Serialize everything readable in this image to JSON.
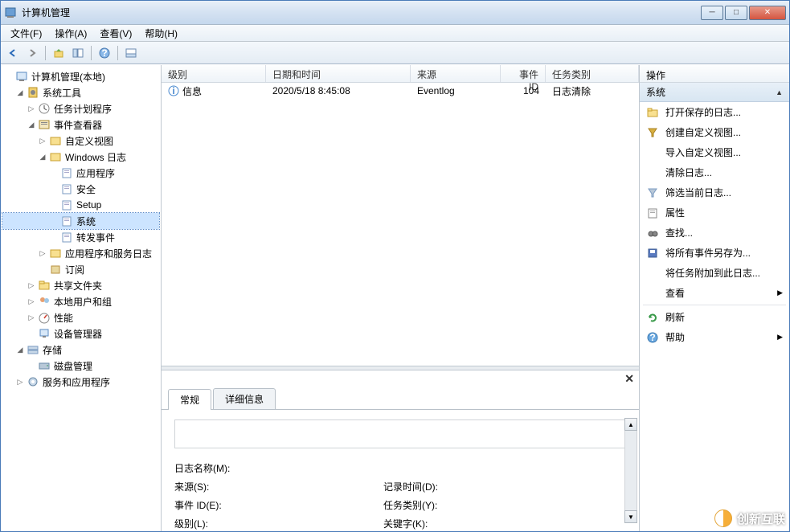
{
  "window": {
    "title": "计算机管理"
  },
  "menu": {
    "file": "文件(F)",
    "action": "操作(A)",
    "view": "查看(V)",
    "help": "帮助(H)"
  },
  "tree": {
    "root": "计算机管理(本地)",
    "system_tools": "系统工具",
    "task_scheduler": "任务计划程序",
    "event_viewer": "事件查看器",
    "custom_views": "自定义视图",
    "windows_logs": "Windows 日志",
    "application": "应用程序",
    "security": "安全",
    "setup": "Setup",
    "system": "系统",
    "forwarded": "转发事件",
    "app_service_logs": "应用程序和服务日志",
    "subscriptions": "订阅",
    "shared_folders": "共享文件夹",
    "local_users": "本地用户和组",
    "performance": "性能",
    "device_manager": "设备管理器",
    "storage": "存储",
    "disk_mgmt": "磁盘管理",
    "services_apps": "服务和应用程序"
  },
  "grid": {
    "col_level": "级别",
    "col_datetime": "日期和时间",
    "col_source": "来源",
    "col_eventid": "事件 ID",
    "col_taskcat": "任务类别",
    "rows": [
      {
        "level": "信息",
        "datetime": "2020/5/18 8:45:08",
        "source": "Eventlog",
        "eventid": "104",
        "taskcat": "日志清除"
      }
    ]
  },
  "detail": {
    "tab_general": "常规",
    "tab_details": "详细信息",
    "log_name": "日志名称(M):",
    "source": "来源(S):",
    "event_id": "事件 ID(E):",
    "level": "级别(L):",
    "record_time": "记录时间(D):",
    "task_cat": "任务类别(Y):",
    "keyword": "关键字(K):"
  },
  "actions": {
    "title": "操作",
    "section": "系统",
    "open_saved": "打开保存的日志...",
    "create_custom": "创建自定义视图...",
    "import_custom": "导入自定义视图...",
    "clear_log": "清除日志...",
    "filter_current": "筛选当前日志...",
    "properties": "属性",
    "find": "查找...",
    "save_all": "将所有事件另存为...",
    "attach_task": "将任务附加到此日志...",
    "view": "查看",
    "refresh": "刷新",
    "help": "帮助"
  },
  "watermark": "创新互联"
}
